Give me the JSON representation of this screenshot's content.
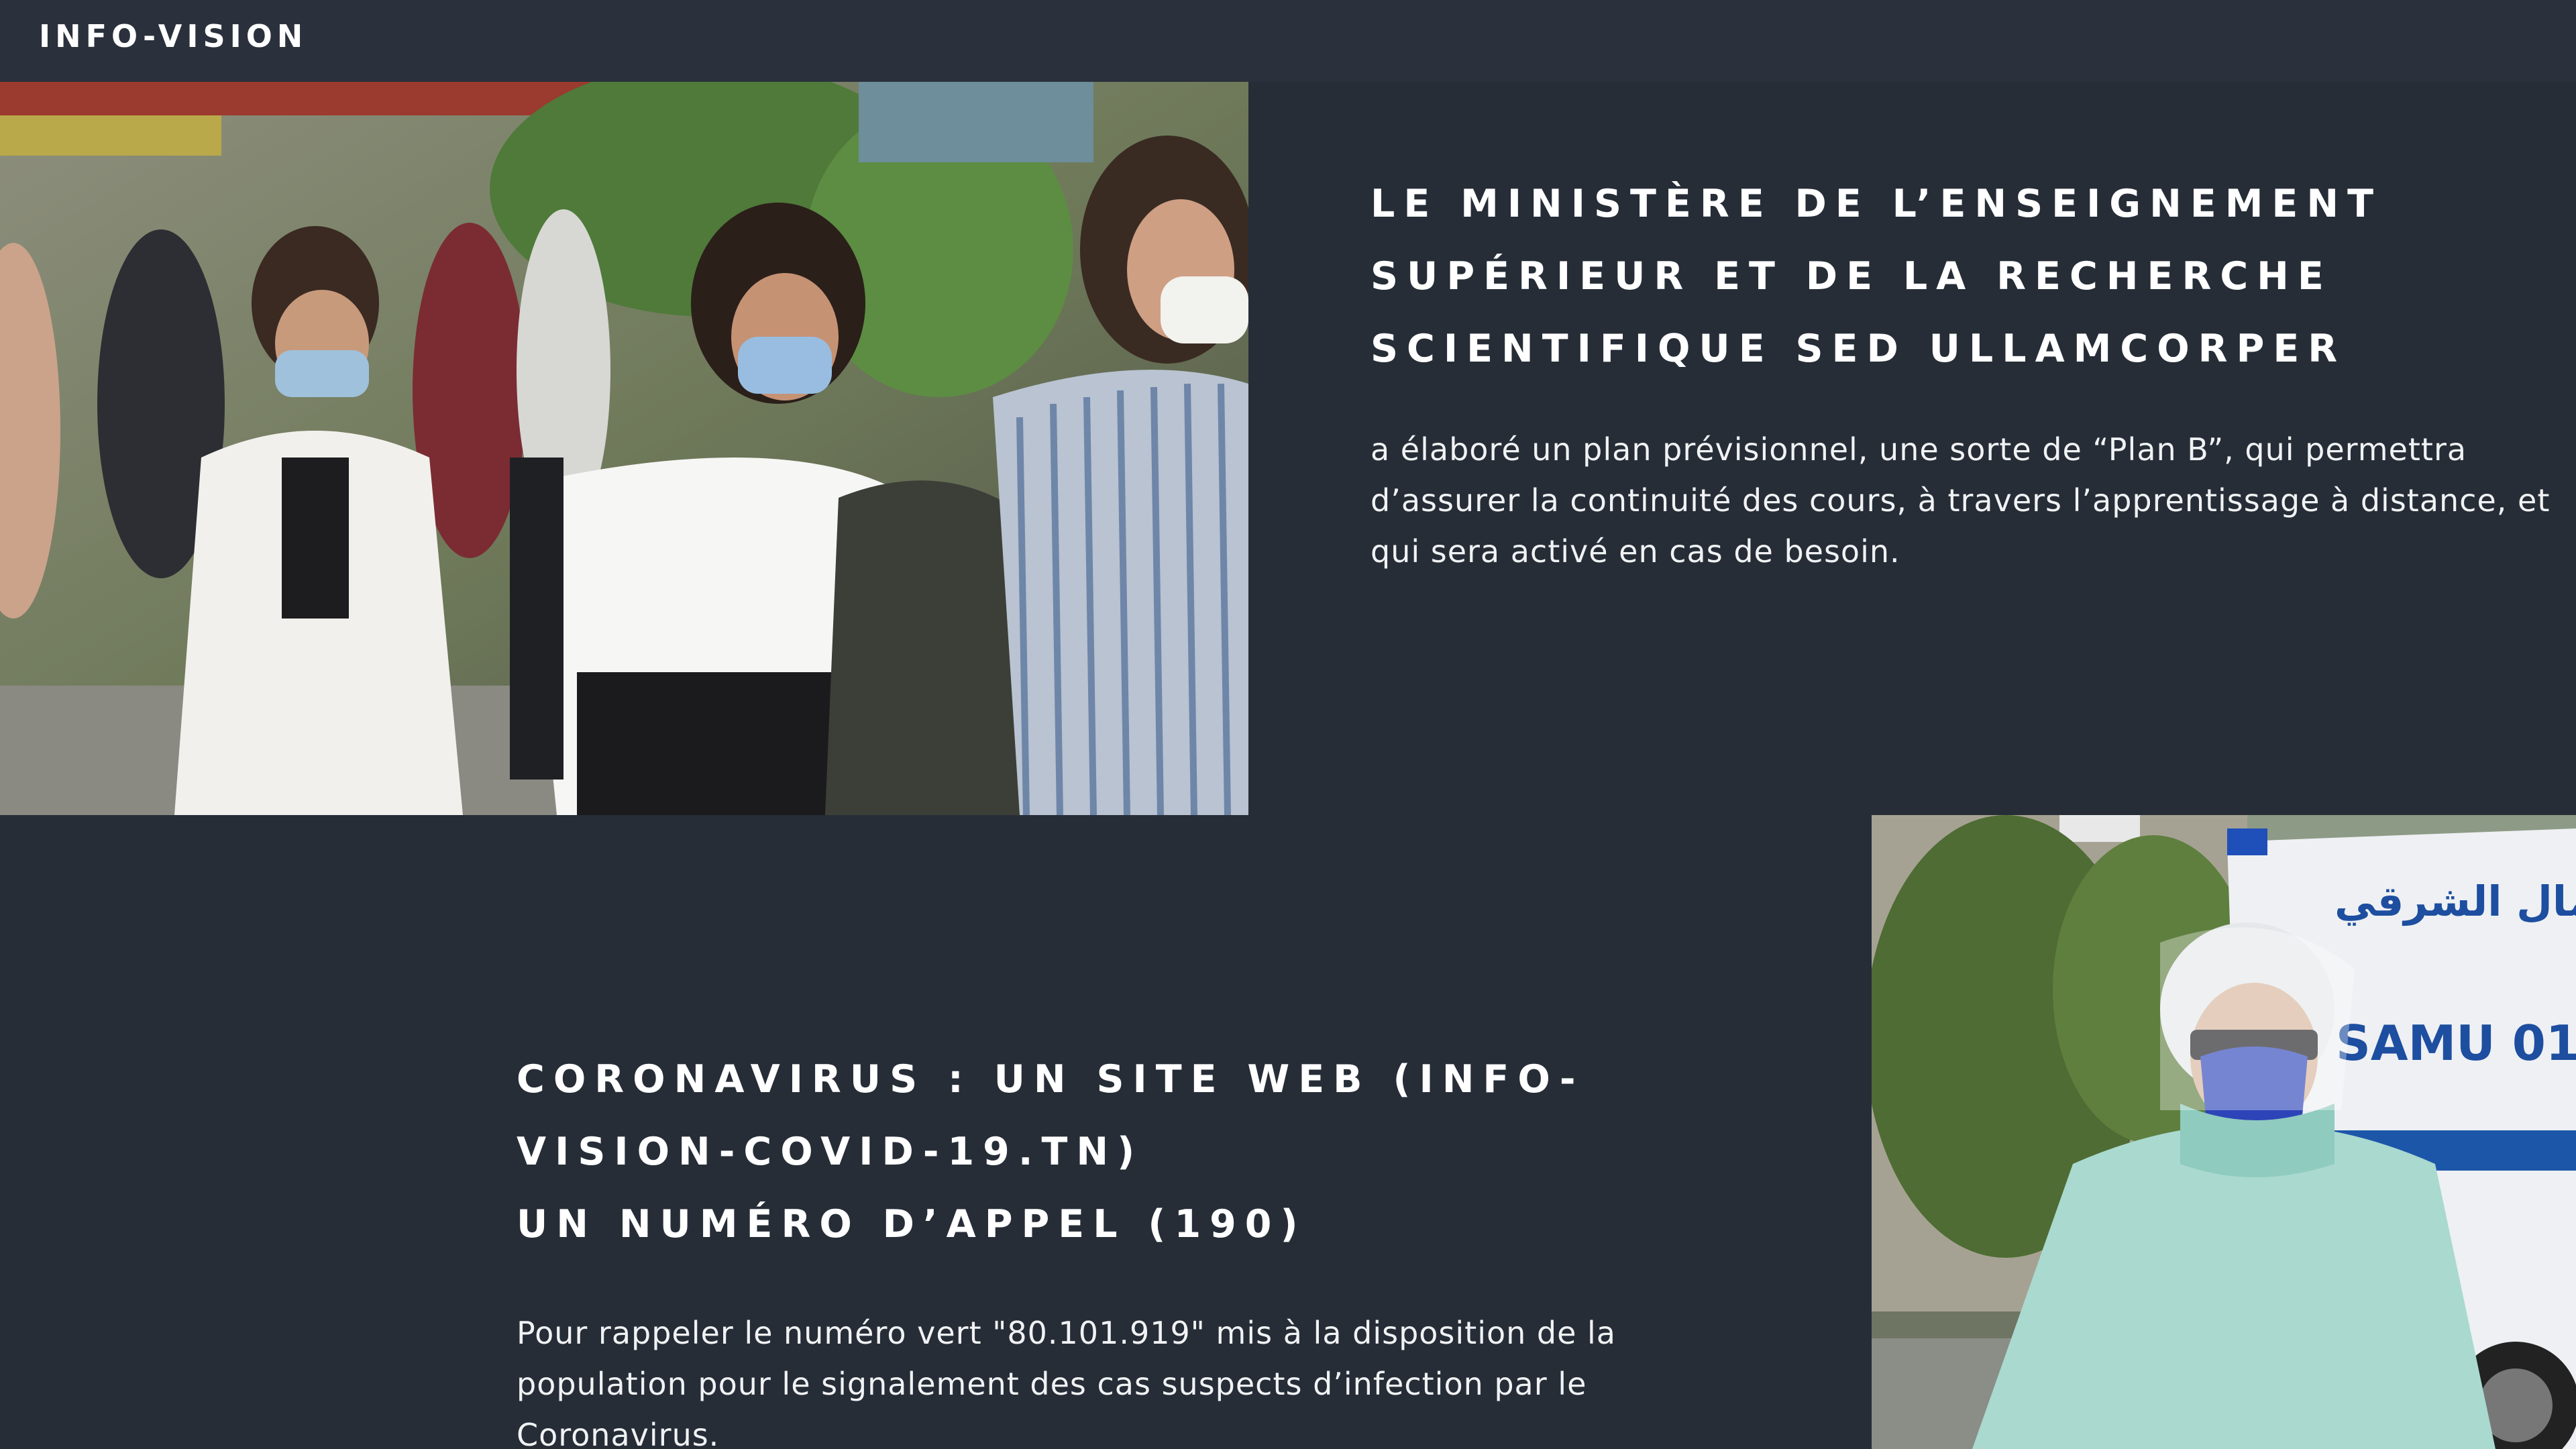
{
  "brand": {
    "name": "INFO-VISION"
  },
  "colors": {
    "background": "#262d37",
    "header_background": "#2a313c",
    "text": "#ffffff"
  },
  "sections": [
    {
      "heading_lines": [
        "LE MINISTÈRE DE L’ENSEIGNEMENT",
        "SUPÉRIEUR ET DE LA RECHERCHE",
        "SCIENTIFIQUE SED ULLAMCORPER"
      ],
      "body_lines": [
        "a élaboré un plan prévisionnel, une sorte de “Plan B”, qui permettra",
        "d’assurer la continuité des cours, à travers l’apprentissage à distance, et",
        "qui sera activé en cas de besoin."
      ],
      "image": "students-wearing-masks-photo"
    },
    {
      "heading_lines": [
        "CORONAVIRUS : UN SITE WEB (INFO-",
        "VISION-COVID-19.TN)",
        "UN NUMÉRO D’APPEL (190)"
      ],
      "body_lines": [
        "Pour rappeler le numéro vert \"80.101.919\" mis à la disposition de la",
        "population pour le signalement des cas suspects d’infection par le",
        "Coronavirus."
      ],
      "image": "paramedic-ambulance-photo",
      "image_text": {
        "ambulance_arabic": "بالشمال الشرقي",
        "ambulance_label": "SAMU 01"
      }
    }
  ]
}
